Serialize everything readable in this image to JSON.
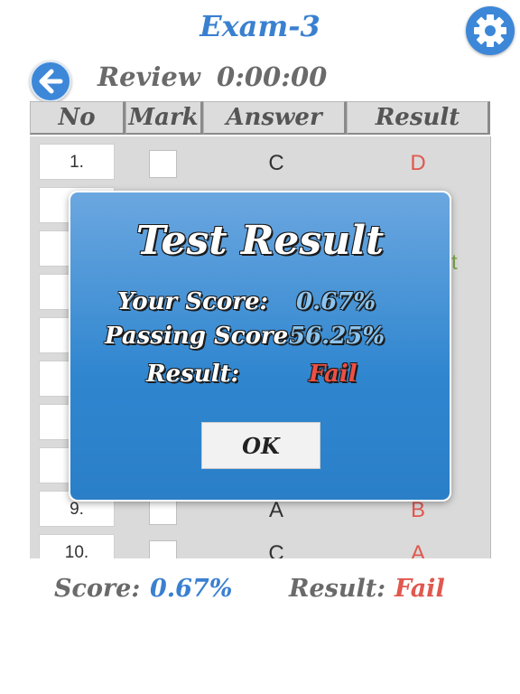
{
  "header": {
    "title": "Exam-3",
    "settings_icon": "gear-icon",
    "back_icon": "arrow-left-icon"
  },
  "review": {
    "label": "Review",
    "timer": "0:00:00"
  },
  "table": {
    "columns": [
      "No",
      "Mark",
      "Answer",
      "Result"
    ],
    "rows": [
      {
        "no": "1.",
        "answer": "C",
        "result": "D"
      },
      {
        "no": "",
        "answer": "",
        "result": ""
      },
      {
        "no": "",
        "answer": "",
        "result": ""
      },
      {
        "no": "",
        "answer": "",
        "result": ""
      },
      {
        "no": "",
        "answer": "",
        "result": ""
      },
      {
        "no": "",
        "answer": "",
        "result": ""
      },
      {
        "no": "",
        "answer": "",
        "result": ""
      },
      {
        "no": "",
        "answer": "",
        "result": ""
      },
      {
        "no": "9.",
        "answer": "A",
        "result": "B"
      },
      {
        "no": "10.",
        "answer": "C",
        "result": "A"
      }
    ],
    "partial_text": "t"
  },
  "footer": {
    "score_label": "Score:",
    "score_value": "0.67%",
    "result_label": "Result:",
    "result_value": "Fail"
  },
  "modal": {
    "title": "Test Result",
    "your_score_label": "Your Score:",
    "your_score_value": "0.67%",
    "passing_score_label": "Passing Score:",
    "passing_score_value": "56.25%",
    "result_label": "Result:",
    "result_value": "Fail",
    "ok_label": "OK"
  },
  "colors": {
    "accent_blue": "#3a80d0",
    "fail_red": "#e0584f",
    "modal_blue": "#2f86cf"
  }
}
